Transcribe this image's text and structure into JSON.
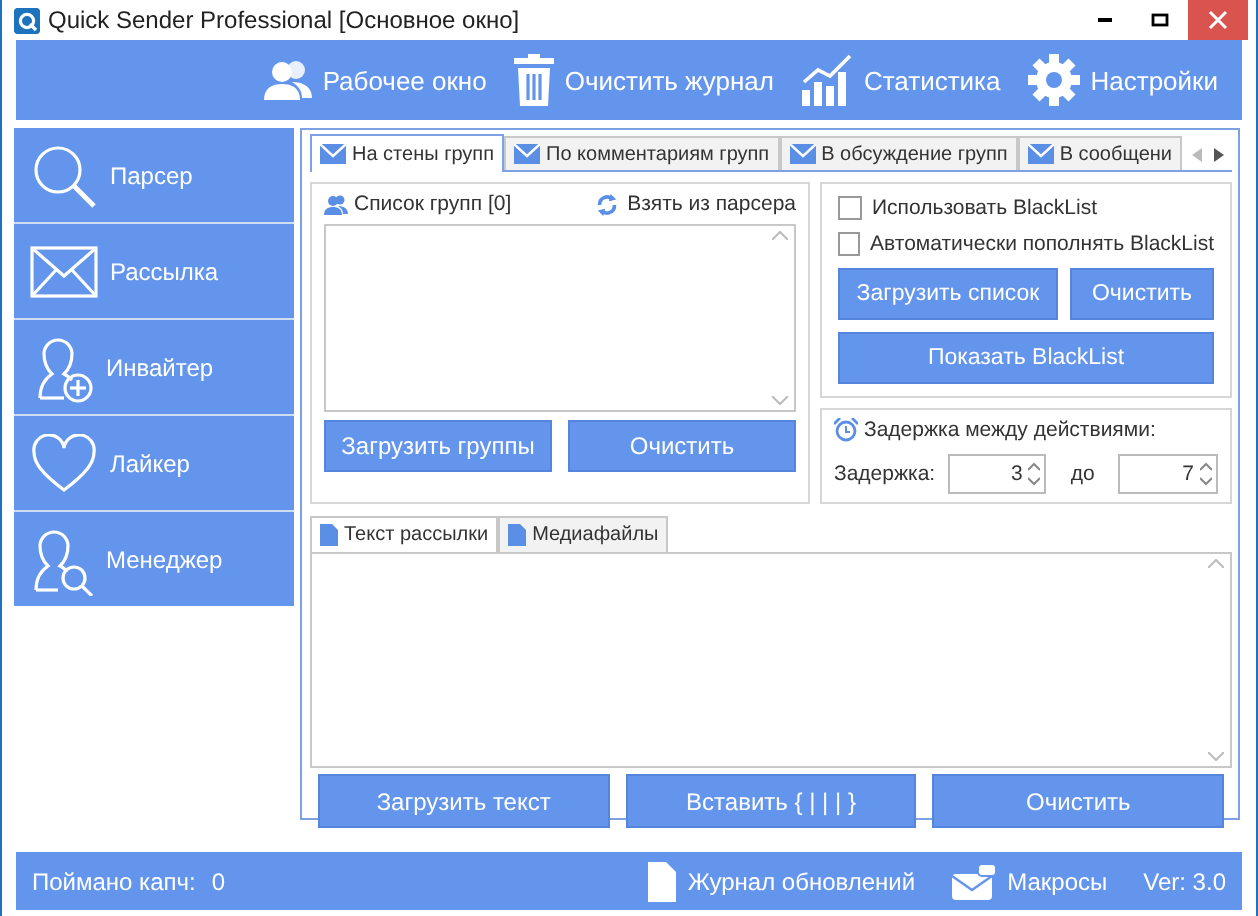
{
  "window": {
    "title": "Quick Sender Professional [Основное окно]"
  },
  "toolbar": [
    {
      "label": "Рабочее окно",
      "kind": "users"
    },
    {
      "label": "Очистить журнал",
      "kind": "trash"
    },
    {
      "label": "Статистика",
      "kind": "chart"
    },
    {
      "label": "Настройки",
      "kind": "gear"
    }
  ],
  "sidebar": {
    "items": [
      {
        "label": "Парсер",
        "kind": "search"
      },
      {
        "label": "Рассылка",
        "kind": "mail"
      },
      {
        "label": "Инвайтер",
        "kind": "invite"
      },
      {
        "label": "Лайкер",
        "kind": "heart"
      },
      {
        "label": "Менеджер",
        "kind": "manager"
      }
    ]
  },
  "tabs": [
    {
      "label": "На стены групп",
      "selected": true
    },
    {
      "label": "По комментариям групп",
      "selected": false
    },
    {
      "label": "В обсуждение групп",
      "selected": false
    },
    {
      "label": "В сообщени",
      "selected": false
    }
  ],
  "groups": {
    "title": "Список групп [0]",
    "link": "Взять из парсера",
    "buttons": [
      "Загрузить группы",
      "Очистить"
    ]
  },
  "blacklist": {
    "options": [
      {
        "label": "Использовать BlackList",
        "checked": false
      },
      {
        "label": "Автоматически пополнять BlackList",
        "checked": false
      }
    ],
    "buttons": [
      "Загрузить список",
      "Очистить",
      "Показать BlackList"
    ]
  },
  "delay": {
    "title": "Задержка между действиями:",
    "label": "Задержка:",
    "from": "3",
    "to_label": "до",
    "to": "7"
  },
  "text_tabs": [
    {
      "label": "Текст рассылки",
      "selected": true
    },
    {
      "label": "Медиафайлы",
      "selected": false
    }
  ],
  "text_buttons": [
    "Загрузить текст",
    "Вставить { | | | }",
    "Очистить"
  ],
  "status_bar": {
    "captcha_label": "Поймано капч:",
    "captcha_count": "0",
    "updates": "Журнал обновлений",
    "macros": "Макросы",
    "version": "Ver: 3.0"
  }
}
